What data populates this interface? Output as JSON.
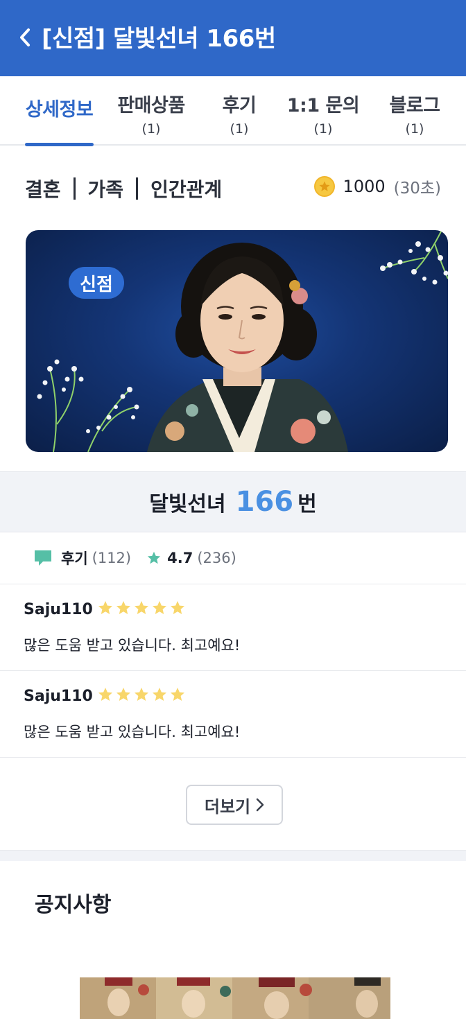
{
  "header": {
    "title": "[신점] 달빛선녀 166번",
    "back_icon": "chevron-left-icon"
  },
  "tabs": [
    {
      "label": "상세정보",
      "count": "",
      "active": true
    },
    {
      "label": "판매상품",
      "count": "(1)",
      "active": false
    },
    {
      "label": "후기",
      "count": "(1)",
      "active": false
    },
    {
      "label": "1:1 문의",
      "count": "(1)",
      "active": false
    },
    {
      "label": "블로그",
      "count": "(1)",
      "active": false
    }
  ],
  "categories": [
    "결혼",
    "가족",
    "인간관계"
  ],
  "price": {
    "coins": "1000",
    "duration": "(30초)",
    "icon": "coin-star-icon"
  },
  "banner": {
    "badge": "신점"
  },
  "counselor": {
    "name": "달빛선녀",
    "number": "166",
    "suffix": "번"
  },
  "stats": {
    "review_label": "후기",
    "review_count": "(112)",
    "rating": "4.7",
    "rating_count": "(236)"
  },
  "reviews": [
    {
      "author": "Saju110",
      "stars": 5,
      "text": "많은 도움 받고 있습니다. 최고예요!"
    },
    {
      "author": "Saju110",
      "stars": 5,
      "text": "많은 도움 받고 있습니다. 최고예요!"
    }
  ],
  "more_button": "더보기",
  "notice": {
    "title": "공지사항"
  },
  "colors": {
    "primary": "#2f68c8",
    "accent_number": "#4a90e2",
    "star": "#f8d66a",
    "teal": "#55bfa6"
  }
}
